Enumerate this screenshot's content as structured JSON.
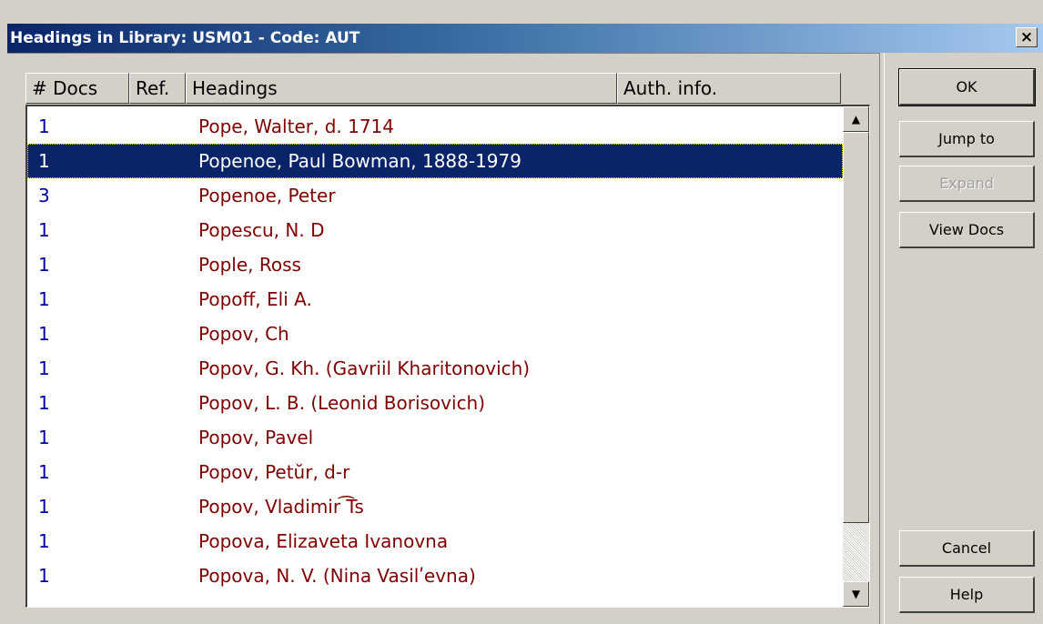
{
  "window": {
    "title": "Headings in Library: USM01 - Code: AUT",
    "close_label": "×"
  },
  "columns": {
    "docs": "# Docs",
    "ref": "Ref.",
    "headings": "Headings",
    "auth": "Auth. info."
  },
  "rows": [
    {
      "docs": "1",
      "heading": "Pope, Walter, d. 1714"
    },
    {
      "docs": "1",
      "heading": "Popenoe, Paul Bowman, 1888-1979",
      "selected": true
    },
    {
      "docs": "3",
      "heading": "Popenoe, Peter"
    },
    {
      "docs": "1",
      "heading": "Popescu, N. D"
    },
    {
      "docs": "1",
      "heading": "Pople, Ross"
    },
    {
      "docs": "1",
      "heading": "Popoff, Eli A."
    },
    {
      "docs": "1",
      "heading": "Popov, Ch"
    },
    {
      "docs": "1",
      "heading": "Popov, G. Kh. (Gavriil Kharitonovich)"
    },
    {
      "docs": "1",
      "heading": "Popov, L. B. (Leonid Borisovich)"
    },
    {
      "docs": "1",
      "heading": "Popov, Pavel"
    },
    {
      "docs": "1",
      "heading": "Popov, Petŭr, d-r"
    },
    {
      "docs": "1",
      "heading": "Popov, Vladimir ͡Ts"
    },
    {
      "docs": "1",
      "heading": "Popova, Elizaveta Ivanovna"
    },
    {
      "docs": "1",
      "heading": "Popova, N. V. (Nina Vasilʹevna)"
    }
  ],
  "buttons": {
    "ok": "OK",
    "jump": "Jump to",
    "expand": "Expand",
    "view_docs": "View Docs",
    "cancel": "Cancel",
    "help": "Help"
  },
  "scrollbar": {
    "up_icon": "triangle-up",
    "down_icon": "triangle-down"
  },
  "colors": {
    "selection": "#0a246a",
    "docs_text": "#0000a0",
    "heading_text": "#800000"
  }
}
